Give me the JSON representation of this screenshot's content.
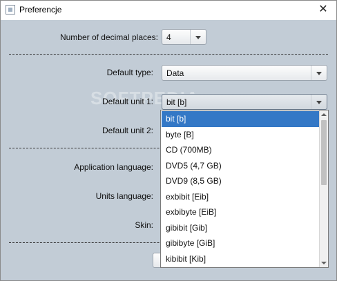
{
  "window": {
    "title": "Preferencje",
    "close_icon": "close-icon"
  },
  "form": {
    "decimal_label": "Number of decimal places:",
    "decimal_value": "4",
    "default_type_label": "Default type:",
    "default_type_value": "Data",
    "unit1_label": "Default unit 1:",
    "unit1_value": "bit [b]",
    "unit2_label": "Default unit 2:",
    "app_language_label": "Application language:",
    "units_language_label": "Units language:",
    "skin_label": "Skin:"
  },
  "watermark": "SOFTPEDIA",
  "dropdown": {
    "items": [
      "bit [b]",
      "byte [B]",
      "CD (700MB)",
      "DVD5 (4,7 GB)",
      "DVD9 (8,5 GB)",
      "exbibit [Eib]",
      "exbibyte [EiB]",
      "gibibit [Gib]",
      "gibibyte [GiB]",
      "kibibit [Kib]"
    ],
    "selected_index": 0
  },
  "colors": {
    "selection": "#3478c6",
    "background": "#c2ccd6"
  }
}
